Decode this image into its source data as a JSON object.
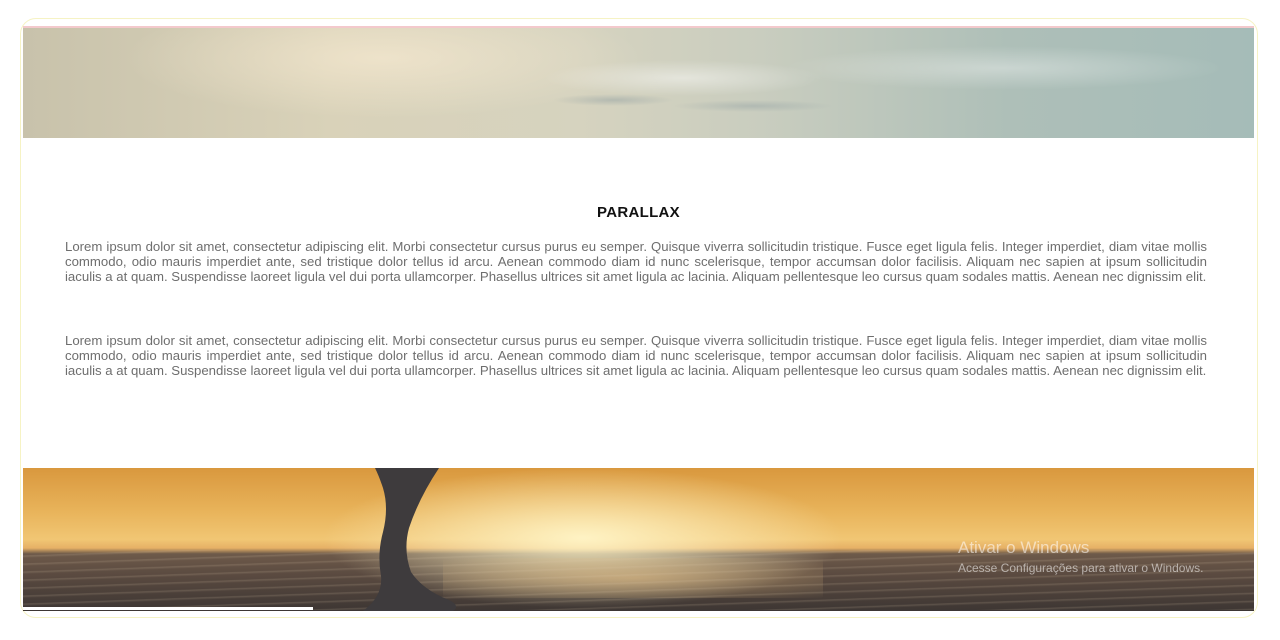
{
  "section": {
    "title": "PARALLAX",
    "paragraphs": [
      "Lorem ipsum dolor sit amet, consectetur adipiscing elit. Morbi consectetur cursus purus eu semper. Quisque viverra sollicitudin tristique. Fusce eget ligula felis. Integer imperdiet, diam vitae mollis commodo, odio mauris imperdiet ante, sed tristique dolor tellus id arcu. Aenean commodo diam id nunc scelerisque, tempor accumsan dolor facilisis. Aliquam nec sapien at ipsum sollicitudin iaculis a at quam. Suspendisse laoreet ligula vel dui porta ullamcorper. Phasellus ultrices sit amet ligula ac lacinia. Aliquam pellentesque leo cursus quam sodales mattis. Aenean nec dignissim elit.",
      "Lorem ipsum dolor sit amet, consectetur adipiscing elit. Morbi consectetur cursus purus eu semper. Quisque viverra sollicitudin tristique. Fusce eget ligula felis. Integer imperdiet, diam vitae mollis commodo, odio mauris imperdiet ante, sed tristique dolor tellus id arcu. Aenean commodo diam id nunc scelerisque, tempor accumsan dolor facilisis. Aliquam nec sapien at ipsum sollicitudin iaculis a at quam. Suspendisse laoreet ligula vel dui porta ullamcorper. Phasellus ultrices sit amet ligula ac lacinia. Aliquam pellentesque leo cursus quam sodales mattis. Aenean nec dignissim elit."
    ]
  },
  "images": {
    "top": "sky-clouds-image",
    "bottom": "sunset-beach-image"
  },
  "watermark": {
    "title": "Ativar o Windows",
    "subtitle": "Acesse Configurações para ativar o Windows."
  },
  "colors": {
    "title": "#111111",
    "body_text": "#6e6e6e",
    "frame_border": "#f6f3c4"
  }
}
